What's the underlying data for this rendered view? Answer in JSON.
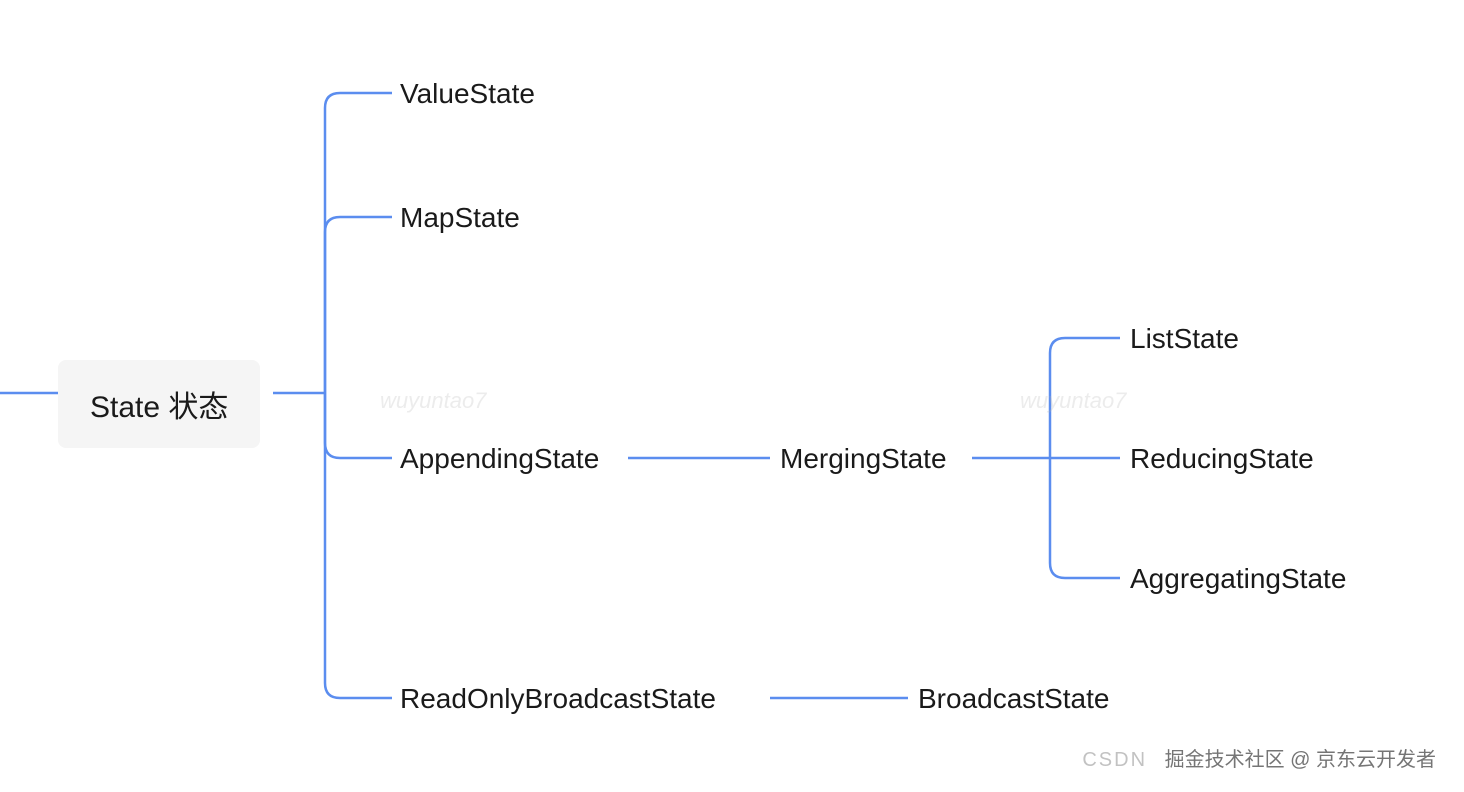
{
  "root": {
    "label": "State 状态"
  },
  "level1": {
    "n0": "ValueState",
    "n1": "MapState",
    "n2": "AppendingState",
    "n3": "ReadOnlyBroadcastState"
  },
  "level2": {
    "merging": "MergingState",
    "broadcast": "BroadcastState"
  },
  "level3": {
    "n0": "ListState",
    "n1": "ReducingState",
    "n2": "AggregatingState"
  },
  "watermarks": {
    "w1": "wuyuntao7",
    "w2": "wuyuntao7"
  },
  "footer": {
    "faint": "CSDN",
    "text": "掘金技术社区 @ 京东云开发者"
  },
  "colors": {
    "line": "#5b8def",
    "rootBg": "#f5f5f5"
  }
}
